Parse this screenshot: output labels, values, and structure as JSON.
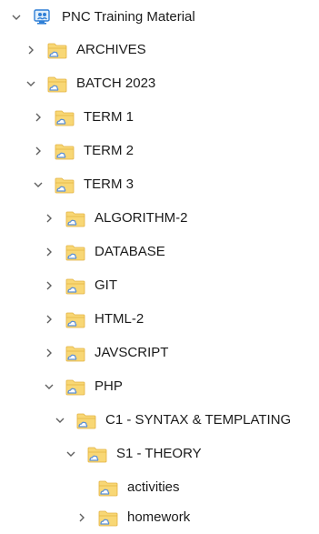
{
  "tree": {
    "root": {
      "label": "PNC Training Material",
      "icon": "onedrive-computer-icon",
      "expanded": true
    },
    "items": [
      {
        "label": "ARCHIVES",
        "icon": "cloud-folder-icon",
        "chevron": "right"
      },
      {
        "label": "BATCH 2023",
        "icon": "cloud-folder-icon",
        "chevron": "down"
      },
      {
        "label": "TERM 1",
        "icon": "cloud-folder-icon",
        "chevron": "right"
      },
      {
        "label": "TERM 2",
        "icon": "cloud-folder-icon",
        "chevron": "right"
      },
      {
        "label": "TERM 3",
        "icon": "cloud-folder-icon",
        "chevron": "down"
      },
      {
        "label": "ALGORITHM-2",
        "icon": "cloud-folder-icon",
        "chevron": "right"
      },
      {
        "label": "DATABASE",
        "icon": "cloud-folder-icon",
        "chevron": "right"
      },
      {
        "label": "GIT",
        "icon": "cloud-folder-icon",
        "chevron": "right"
      },
      {
        "label": "HTML-2",
        "icon": "cloud-folder-icon",
        "chevron": "right"
      },
      {
        "label": "JAVSCRIPT",
        "icon": "cloud-folder-icon",
        "chevron": "right"
      },
      {
        "label": "PHP",
        "icon": "cloud-folder-icon",
        "chevron": "down"
      },
      {
        "label": "C1 - SYNTAX & TEMPLATING",
        "icon": "cloud-folder-icon",
        "chevron": "down"
      },
      {
        "label": "S1 - THEORY",
        "icon": "cloud-folder-icon",
        "chevron": "down"
      },
      {
        "label": "activities",
        "icon": "cloud-folder-icon",
        "chevron": "none"
      },
      {
        "label": "homework",
        "icon": "cloud-folder-icon",
        "chevron": "right"
      }
    ]
  },
  "colors": {
    "folder": "#f8d775",
    "folder_dark": "#e3b341",
    "cloud": "#5a8fd6",
    "chevron": "#606060",
    "root_icon": "#2f7fd6"
  }
}
